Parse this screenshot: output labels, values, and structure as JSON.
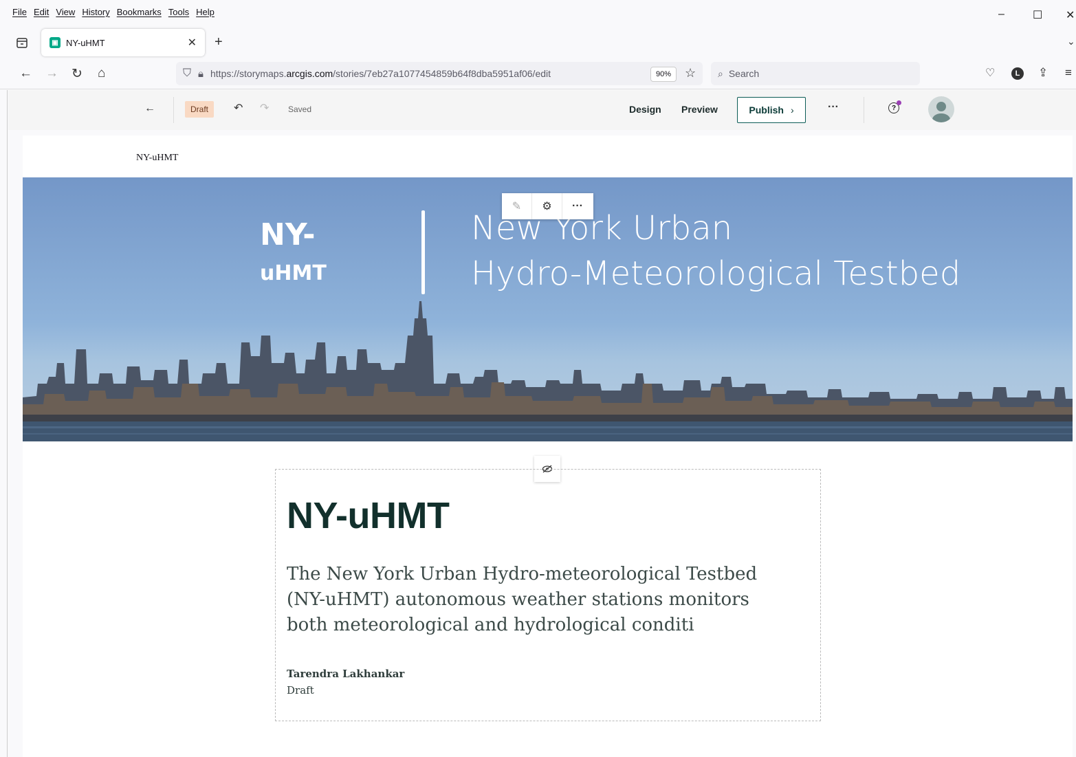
{
  "menu": [
    "File",
    "Edit",
    "View",
    "History",
    "Bookmarks",
    "Tools",
    "Help"
  ],
  "browser": {
    "tab_title": "NY-uHMT",
    "url_prefix": "https://storymaps.",
    "url_host": "arcgis.com",
    "url_path": "/stories/7eb27a1077454859b64f8dba5951af06/edit",
    "zoom": "90%",
    "search_placeholder": "Search",
    "account_initial": "L"
  },
  "toolbar": {
    "back_arrow": "←",
    "draft_label": "Draft",
    "saved_label": "Saved",
    "design_label": "Design",
    "preview_label": "Preview",
    "publish_label": "Publish",
    "more_label": "···"
  },
  "story": {
    "header_title": "NY-uHMT",
    "hero_ny": "NY-",
    "hero_uhmt": "uHMT",
    "hero_line1": "New York Urban",
    "hero_line2": "Hydro-Meteorological Testbed",
    "title": "NY-uHMT",
    "description": " The New York Urban Hydro-meteorological Testbed (NY-uHMT) autonomous weather stations monitors both meteorological and hydrological conditi",
    "author": "Tarendra Lakhankar",
    "status": "Draft"
  },
  "colors": {
    "accent": "#0b5c55",
    "draft_badge_bg": "#f9d9c3",
    "title_color": "#12302c",
    "sky_top": "#7497c8"
  }
}
